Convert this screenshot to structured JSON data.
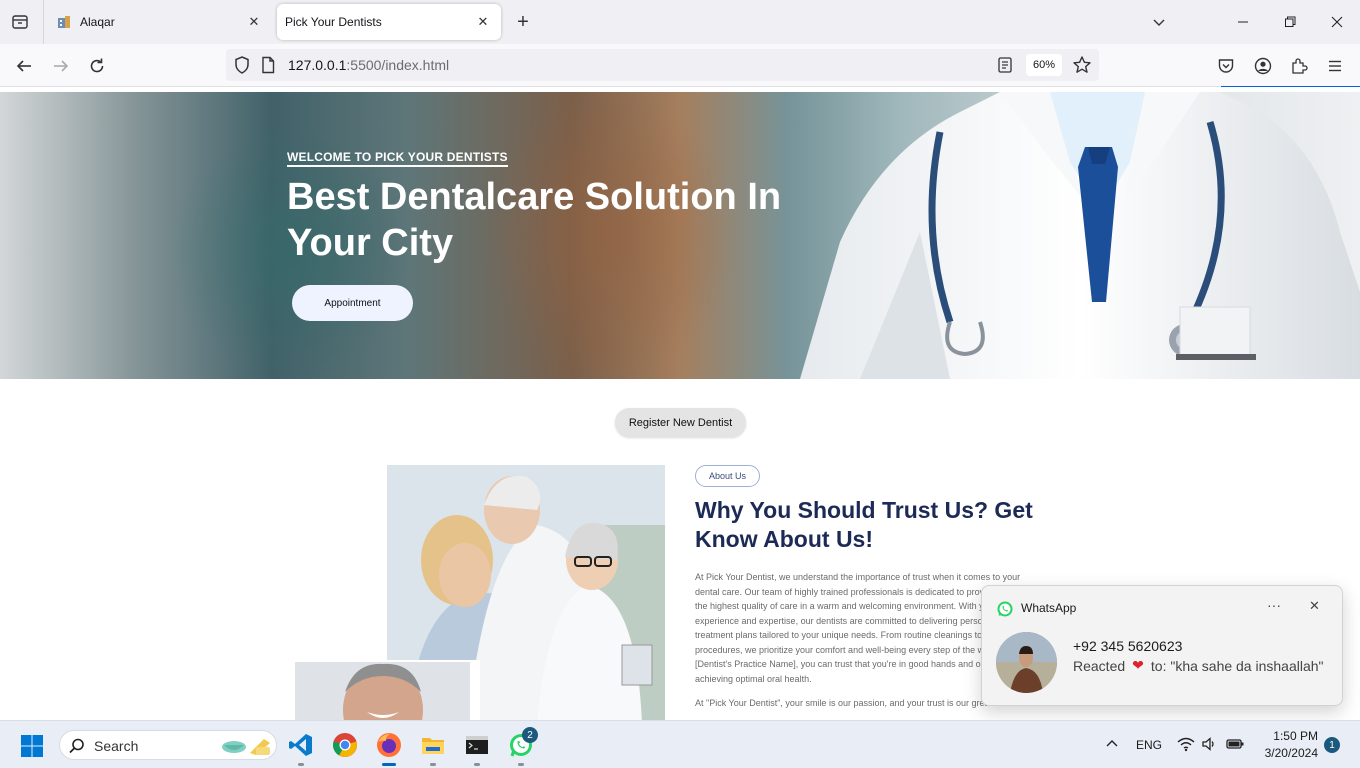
{
  "browser": {
    "tabs": [
      {
        "title": "Alaqar",
        "active": false
      },
      {
        "title": "Pick Your Dentists",
        "active": true
      }
    ],
    "url_host": "127.0.0.1",
    "url_rest": ":5500/index.html",
    "zoom": "60%"
  },
  "hero": {
    "kicker": "WELCOME TO PICK YOUR DENTISTS",
    "title": "Best Dentalcare Solution In Your City",
    "button": "Appointment"
  },
  "register": {
    "button": "Register New Dentist"
  },
  "about": {
    "badge": "About Us",
    "title": "Why You Should Trust Us? Get Know About Us!",
    "p1": "At Pick Your Dentist, we understand the importance of trust when it comes to your dental care. Our team of highly trained professionals is dedicated to providing you with the highest quality of care in a warm and welcoming environment. With years of experience and expertise, our dentists are committed to delivering personalized treatment plans tailored to your unique needs. From routine cleanings to advanced procedures, we prioritize your comfort and well-being every step of the way. By choosing [Dentist's Practice Name], you can trust that you're in good hands and on your way to achieving optimal oral health.",
    "p2": "At \"Pick Your Dentist\", your smile is our passion, and your trust is our greatest reward."
  },
  "notification": {
    "app": "WhatsApp",
    "sender": "+92 345 5620623",
    "reaction_prefix": "Reacted",
    "reaction_suffix": "to: \"kha sahe da inshaallah\""
  },
  "taskbar": {
    "search_label": "Search",
    "whatsapp_badge": "2",
    "language": "ENG",
    "time": "1:50 PM",
    "date": "3/20/2024",
    "notification_count": "1"
  },
  "colors": {
    "heading_navy": "#1c2a55",
    "accent_blue": "#0060df",
    "heart_red": "#e0202c"
  }
}
